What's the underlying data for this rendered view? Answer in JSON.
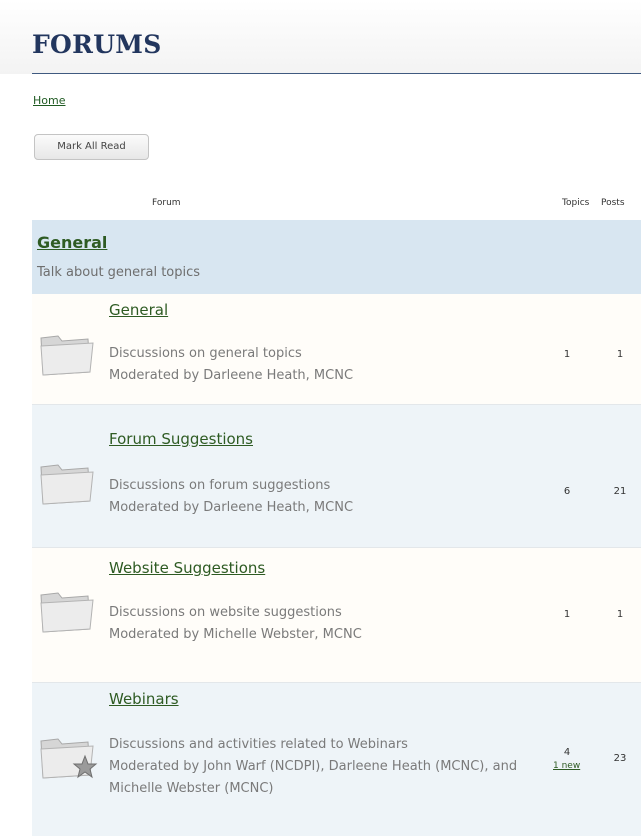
{
  "header": {
    "title": "FORUMS"
  },
  "breadcrumb": {
    "home": "Home"
  },
  "actions": {
    "mark_all_read": "Mark All Read"
  },
  "columns": {
    "forum": "Forum",
    "topics": "Topics",
    "posts": "Posts"
  },
  "category": {
    "title": "General",
    "description": "Talk about general topics"
  },
  "forums": [
    {
      "name": "General",
      "description": "Discussions on general topics",
      "moderated": "Moderated by Darleene Heath, MCNC",
      "topics": "1",
      "posts": "1",
      "icon": "folder-icon"
    },
    {
      "name": "Forum Suggestions",
      "description": "Discussions on forum suggestions",
      "moderated": "Moderated by Darleene Heath, MCNC",
      "topics": "6",
      "posts": "21",
      "icon": "folder-icon"
    },
    {
      "name": "Website Suggestions",
      "description": "Discussions on website suggestions",
      "moderated": "Moderated by Michelle Webster, MCNC",
      "topics": "1",
      "posts": "1",
      "icon": "folder-icon"
    },
    {
      "name": "Webinars",
      "description": "Discussions and activities related to Webinars",
      "moderated": "Moderated by John Warf (NCDPI), Darleene Heath (MCNC), and Michelle Webster (MCNC)",
      "topics": "4",
      "new_label": "1 new",
      "posts": "23",
      "icon": "folder-star-icon"
    }
  ],
  "colors": {
    "title": "#22365e",
    "link": "#2e5b23",
    "category_bg": "#d8e6f1",
    "row_alt_bg": "#eef4f8"
  }
}
